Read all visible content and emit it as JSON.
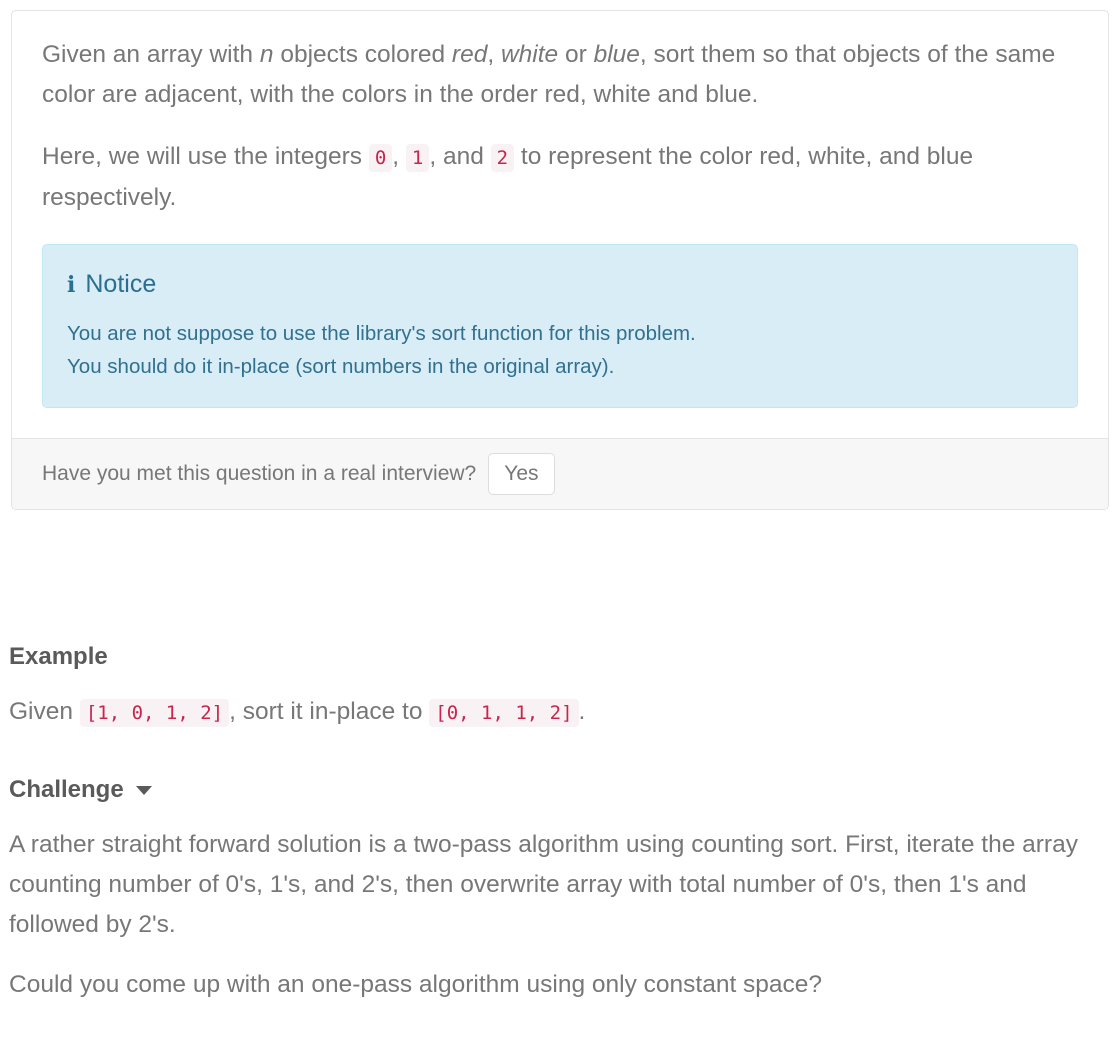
{
  "problem_panel": {
    "paragraph_1": {
      "t1": "Given an array with ",
      "em1": "n",
      "t2": " objects colored ",
      "em2": "red",
      "t3": ", ",
      "em3": "white",
      "t4": " or ",
      "em4": "blue",
      "t5": ", sort them so that objects of the same color are adjacent, with the colors in the order red, white and blue."
    },
    "paragraph_2": {
      "t1": "Here, we will use the integers ",
      "code1": "0",
      "t2": ", ",
      "code2": "1",
      "t3": ", and ",
      "code3": "2",
      "t4": " to represent the color red, white, and blue respectively."
    },
    "notice": {
      "icon": "info-icon",
      "icon_glyph": "i",
      "title": "Notice",
      "line_1": "You are not suppose to use the library's sort function for this problem.",
      "line_2": "You should do it in-place (sort numbers in the original array)."
    },
    "footer": {
      "question": "Have you met this question in a real interview?",
      "yes_label": "Yes"
    }
  },
  "example_section": {
    "heading": "Example",
    "t1": "Given ",
    "code1": "[1, 0, 1, 2]",
    "t2": ", sort it in-place to ",
    "code2": "[0, 1, 1, 2]",
    "t3": "."
  },
  "challenge_section": {
    "heading": "Challenge",
    "caret_icon": "chevron-down-icon",
    "paragraph_1": "A rather straight forward solution is a two-pass algorithm using counting sort. First, iterate the array counting number of 0's, 1's, and 2's, then overwrite array with total number of 0's, then 1's and followed by 2's.",
    "paragraph_2": "Could you come up with an one-pass algorithm using only constant space?"
  },
  "colors": {
    "text": "#777777",
    "heading": "#5a5a5a",
    "code_text": "#c7254e",
    "code_bg": "#f9f2f4",
    "notice_bg": "#d9edf7",
    "notice_border": "#bce8f1",
    "notice_text": "#31708f",
    "panel_border": "#e3e3e3",
    "panel_footer_bg": "#f7f7f7"
  }
}
